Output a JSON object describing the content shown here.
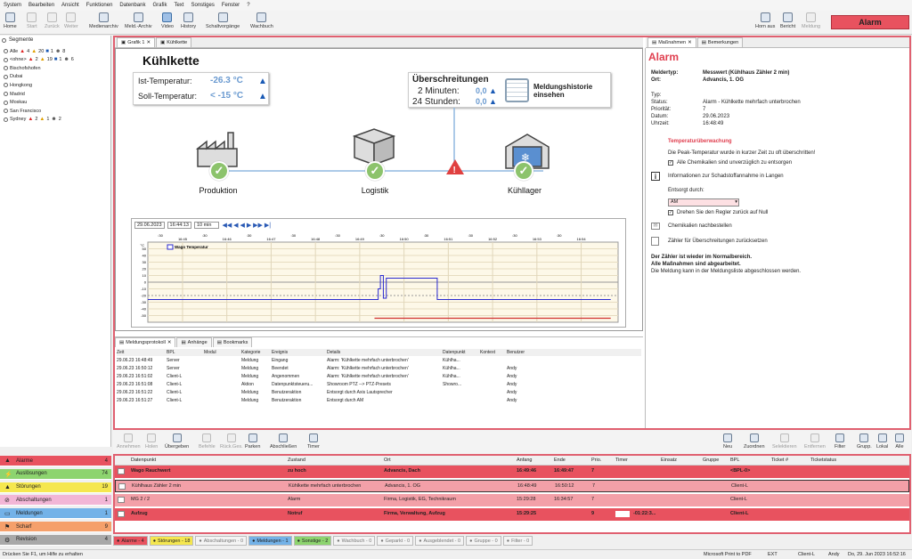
{
  "menu": [
    "System",
    "Bearbeiten",
    "Ansicht",
    "Funktionen",
    "Datenbank",
    "Grafik",
    "Text",
    "Sonstiges",
    "Fenster",
    "?"
  ],
  "toolbar": {
    "left": [
      {
        "label": "Home",
        "enabled": true,
        "active": false
      },
      {
        "label": "Start",
        "enabled": false,
        "active": false
      },
      {
        "label": "Zurück",
        "enabled": false,
        "active": false
      },
      {
        "label": "Weiter",
        "enabled": false,
        "active": false
      },
      {
        "label": "Medienarchiv",
        "enabled": true,
        "active": false
      },
      {
        "label": "Meld.-Archiv",
        "enabled": true,
        "active": false
      },
      {
        "label": "Video",
        "enabled": true,
        "active": true
      },
      {
        "label": "History",
        "enabled": true,
        "active": false
      },
      {
        "label": "Schaltvorgänge",
        "enabled": true,
        "active": false
      },
      {
        "label": "Wachbuch",
        "enabled": true,
        "active": false
      }
    ],
    "right": [
      {
        "label": "Horn aus",
        "enabled": true
      },
      {
        "label": "Bericht",
        "enabled": true
      },
      {
        "label": "Meldung",
        "enabled": false
      }
    ],
    "alarm_label": "Alarm"
  },
  "segments": {
    "title": "Segmente",
    "rows": [
      {
        "name": "Alle",
        "bell": "4",
        "warn": "20",
        "flag": "1",
        "pers": "8"
      },
      {
        "name": "<ohne>",
        "bell": "2",
        "warn": "19",
        "flag": "1",
        "pers": "6"
      },
      {
        "name": "Bischofshofen"
      },
      {
        "name": "Dubai"
      },
      {
        "name": "Hongkong"
      },
      {
        "name": "Madrid"
      },
      {
        "name": "Moskau"
      },
      {
        "name": "San Francisco"
      },
      {
        "name": "Sydney",
        "bell": "2",
        "warn": "1",
        "pers": "2"
      }
    ]
  },
  "categories": [
    {
      "label": "Alarme",
      "count": "4",
      "color": "#e8525f",
      "icon": "bell-icon"
    },
    {
      "label": "Auslösungen",
      "count": "74",
      "color": "#8dd46f",
      "icon": "bolt-icon"
    },
    {
      "label": "Störungen",
      "count": "19",
      "color": "#f5e74f",
      "icon": "warning-icon"
    },
    {
      "label": "Abschaltungen",
      "count": "1",
      "color": "#f2b6d6",
      "icon": "forbidden-icon"
    },
    {
      "label": "Meldungen",
      "count": "1",
      "color": "#73b2e8",
      "icon": "monitor-icon"
    },
    {
      "label": "Scharf",
      "count": "9",
      "color": "#f5a06b",
      "icon": "flag-icon"
    },
    {
      "label": "Revision",
      "count": "4",
      "color": "#a8a8a8",
      "icon": "wrench-icon"
    }
  ],
  "tabs": {
    "left": [
      "Grafik 1",
      "Kühlkette"
    ],
    "right": [
      "Maßnahmen",
      "Bemerkungen"
    ]
  },
  "graphic": {
    "title": "Kühlkette",
    "ist_label": "Ist-Temperatur:",
    "ist_value": "-26.3 °C",
    "soll_label": "Soll-Temperatur:",
    "soll_value": "< -15 °C",
    "ueber_title": "Überschreitungen",
    "min_label": "2 Minuten:",
    "min_value": "0,0",
    "std_label": "24 Stunden:",
    "std_value": "0,0",
    "hist_label1": "Meldungshistorie",
    "hist_label2": "einsehen",
    "stations": [
      "Produktion",
      "Logistik",
      "Kühllager"
    ]
  },
  "chart_controls": {
    "date": "29.06.2023",
    "time": "16:44:13",
    "range": "10 min"
  },
  "chart_data": {
    "type": "line",
    "title": "Wago Temperatur",
    "ylabel": "°C",
    "ylim": [
      -60,
      60
    ],
    "yticks": [
      "50",
      "40",
      "30",
      "20",
      "10",
      "0",
      "-10",
      "-20",
      "-30",
      "-40",
      "-50"
    ],
    "xticks": [
      "16:45",
      "16:46",
      "16:47",
      "16:48",
      "16:49",
      "16:50",
      "16:51",
      "16:52",
      "16:53",
      "16:54"
    ],
    "x_minor_labels": [
      ":30",
      ":30",
      ":30",
      ":30",
      ":30",
      ":30",
      ":30",
      ":30",
      ":30",
      ":30"
    ],
    "series": [
      {
        "name": "Wago Temperatur",
        "color": "#2a2ad0",
        "x": [
          "16:44:13",
          "16:49:20",
          "16:49:25",
          "16:49:28",
          "16:49:32",
          "16:49:36",
          "16:50:42",
          "16:50:45",
          "16:54:40"
        ],
        "y": [
          -26,
          -26,
          -10,
          10,
          -24,
          6,
          6,
          -26,
          -26
        ]
      },
      {
        "name": "",
        "color": "#d03030",
        "x": [
          "16:49:20",
          "16:54:40"
        ],
        "y": [
          -54,
          -54
        ]
      }
    ]
  },
  "protocol": {
    "tabs": [
      "Meldungsprotokoll",
      "Anhänge",
      "Bookmarks"
    ],
    "columns": [
      "Zeit",
      "BPL",
      "Modul",
      "Kategorie",
      "Ereignis",
      "Details",
      "Datenpunkt",
      "Kontext",
      "Benutzer"
    ],
    "rows": [
      [
        "29.06.23 16:48:49",
        "Server",
        "",
        "Meldung",
        "Eingang",
        "Alarm: 'Kühlkette mehrfach unterbrochen'",
        "Kühlha...",
        "",
        ""
      ],
      [
        "29.06.23 16:50:12",
        "Server",
        "",
        "Meldung",
        "Beendet",
        "Alarm: 'Kühlkette mehrfach unterbrochen'",
        "Kühlha...",
        "",
        "Andy"
      ],
      [
        "29.06.23 16:51:02",
        "Client-L",
        "",
        "Meldung",
        "Angenommen",
        "Alarm: 'Kühlkette mehrfach unterbrochen'",
        "Kühlha...",
        "",
        "Andy"
      ],
      [
        "29.06.23 16:51:08",
        "Client-L",
        "",
        "Aktion",
        "Datenpunktsteueru...",
        "Showroom PTZ --> PTZ-Presets",
        "Showro...",
        "",
        "Andy"
      ],
      [
        "29.06.23 16:51:22",
        "Client-L",
        "",
        "Meldung",
        "Benutzeraktion",
        "Entsorgt durch Axis Lautsprecher",
        "",
        "",
        "Andy"
      ],
      [
        "29.06.23 16:51:27",
        "Client-L",
        "",
        "Meldung",
        "Benutzeraktion",
        "Entsorgt durch AM",
        "",
        "",
        "Andy"
      ]
    ]
  },
  "measures": {
    "heading": "Alarm",
    "meldertyp_label": "Meldertyp:",
    "meldertyp": "Messwert (Kühlhaus Zähler 2 min)",
    "ort_label": "Ort:",
    "ort": "Advancis, 1. OG",
    "typ_label": "Typ:",
    "typ": "",
    "status_label": "Status:",
    "status": "Alarm - Kühlkette mehrfach unterbrochen",
    "prio_label": "Priorität:",
    "prio": "7",
    "datum_label": "Datum:",
    "datum": "29.06.2023",
    "uhrzeit_label": "Uhrzeit:",
    "uhrzeit": "16:48:49",
    "section": "Temperaturüberwachung",
    "section_text": "Die Peak-Temperatur wurde in kurzer Zeit zu oft überschritten!",
    "check1": "Alle Chemikalien sind unverzüglich zu entsorgen",
    "info": "Informationen zur Schadstoffannahme in Langen",
    "entsorgt_label": "Entsorgt durch:",
    "entsorgt_value": "AM",
    "check2": "Drehen Sie den Regler zurück auf Null",
    "mail": "Chemikalien nachbestellen",
    "reset": "Zähler für Überschreitungen zurücksetzen",
    "footer1": "Der Zähler ist wieder im Normalbereich.",
    "footer2": "Alle Maßnahmen sind abgearbeitet.",
    "footer3": "Die Meldung kann in der Meldungsliste abgeschlossen werden."
  },
  "bottom_toolbar": {
    "left": [
      {
        "label": "Annehmen",
        "enabled": false
      },
      {
        "label": "Holen",
        "enabled": false
      },
      {
        "label": "Übergeben",
        "enabled": true
      },
      {
        "label": "Befehle",
        "enabled": false
      },
      {
        "label": "Rück.Ges.",
        "enabled": false
      },
      {
        "label": "Parken",
        "enabled": true
      },
      {
        "label": "Abschließen",
        "enabled": true
      },
      {
        "label": "Timer",
        "enabled": true
      }
    ],
    "right": [
      {
        "label": "Neu",
        "enabled": true
      },
      {
        "label": "Zuordnen",
        "enabled": true
      },
      {
        "label": "Selektieren",
        "enabled": false
      },
      {
        "label": "Entfernen",
        "enabled": false
      },
      {
        "label": "Filter",
        "enabled": true
      },
      {
        "label": "Grupp.",
        "enabled": true
      },
      {
        "label": "Lokal",
        "enabled": true
      },
      {
        "label": "Alle",
        "enabled": true
      }
    ]
  },
  "alarm_table": {
    "columns": [
      "Datenpunkt",
      "Zustand",
      "Ort",
      "Anfang",
      "Ende",
      "Prio.",
      "Timer",
      "Einsatz",
      "Gruppe",
      "BPL",
      "Ticket #",
      "Ticketstatus"
    ],
    "rows": [
      {
        "cells": [
          "Wago Rauchwert",
          "zu hoch",
          "Advancis, Dach",
          "16:49:46",
          "16:49:47",
          "7",
          "",
          "",
          "",
          "<BPL-0>",
          "",
          ""
        ],
        "bg": "#e8525f",
        "bold": true,
        "timer": ""
      },
      {
        "cells": [
          "Kühlhaus Zähler 2 min",
          "Kühlkette mehrfach unterbrochen",
          "Advancis, 1. OG",
          "16:48:49",
          "16:50:12",
          "7",
          "",
          "",
          "",
          "Client-L",
          "",
          ""
        ],
        "bg": "#f3a0a8",
        "bold": false,
        "timer": ""
      },
      {
        "cells": [
          "MG 2 / 2",
          "Alarm",
          "Firma, Logistik, EG, Technikraum",
          "15:29:28",
          "16:34:57",
          "7",
          "",
          "",
          "",
          "Client-L",
          "",
          ""
        ],
        "bg": "#f3a0a8",
        "bold": false,
        "timer": ""
      },
      {
        "cells": [
          "Aufzug",
          "Notruf",
          "Firma, Verwaltung, Aufzug",
          "15:29:25",
          "",
          "9",
          "-01:22:3...",
          "",
          "",
          "Client-L",
          "",
          ""
        ],
        "bg": "#e8525f",
        "bold": true,
        "timer": "-01:22:3..."
      }
    ]
  },
  "bottom_tabs": [
    {
      "label": "Alarme - 4",
      "color": "#e8525f"
    },
    {
      "label": "Störungen - 18",
      "color": "#f5e74f"
    },
    {
      "label": "Abschaltungen - 0",
      "color": "#f4f4f4"
    },
    {
      "label": "Meldungen - 1",
      "color": "#73b2e8"
    },
    {
      "label": "Sonstige - 2",
      "color": "#8dd46f"
    },
    {
      "label": "Wachbuch - 0",
      "color": "#f4f4f4"
    },
    {
      "label": "Geparkt - 0",
      "color": "#f4f4f4"
    },
    {
      "label": "Ausgeblendet - 0",
      "color": "#f4f4f4"
    },
    {
      "label": "Gruppe - 0",
      "color": "#f4f4f4"
    },
    {
      "label": "Filter - 0",
      "color": "#f4f4f4"
    }
  ],
  "status": {
    "hint": "Drücken Sie F1, um Hilfe zu erhalten",
    "printer": "Microsoft Print to PDF",
    "ext": "EXT",
    "client": "Client-L",
    "user": "Andy",
    "datetime": "Do, 29. Jun 2023  16:52:16"
  }
}
